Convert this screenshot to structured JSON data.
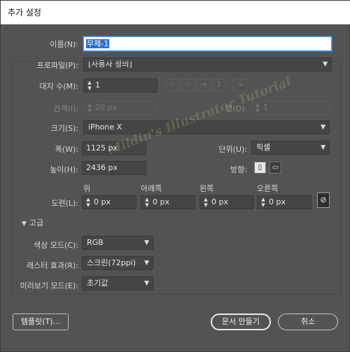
{
  "window": {
    "title": "추가 설정"
  },
  "name": {
    "label": "이름(N):",
    "value": "무제-1"
  },
  "profile": {
    "label": "프로파일(P):",
    "value": "[사용자 정의]"
  },
  "artboards": {
    "label": "대지 수(M):",
    "value": "1"
  },
  "spacing": {
    "label": "간격(I):",
    "value": "20 px"
  },
  "columns": {
    "label": "열(O):",
    "value": "1"
  },
  "size": {
    "label": "크기(S):",
    "value": "iPhone X"
  },
  "width": {
    "label": "폭(W):",
    "value": "1125 px"
  },
  "units": {
    "label": "단위(U):",
    "value": "픽셀"
  },
  "height": {
    "label": "높이(H):",
    "value": "2436 px"
  },
  "orientation": {
    "label": "방향:"
  },
  "bleed": {
    "label": "도련(L):",
    "top_label": "위",
    "top": "0 px",
    "bottom_label": "아래쪽",
    "bottom": "0 px",
    "left_label": "왼쪽",
    "left": "0 px",
    "right_label": "오른쪽",
    "right": "0 px"
  },
  "advanced": {
    "label": "고급"
  },
  "color_mode": {
    "label": "색상 모드(C):",
    "value": "RGB"
  },
  "raster": {
    "label": "래스터 효과(R):",
    "value": "스크린(72ppi)"
  },
  "preview": {
    "label": "미리보기 모드(E):",
    "value": "초기값"
  },
  "buttons": {
    "templates": "템플릿(T)...",
    "create": "문서 만들기",
    "cancel": "취소"
  },
  "watermark": "Mildin's Illustrator Tutorial"
}
